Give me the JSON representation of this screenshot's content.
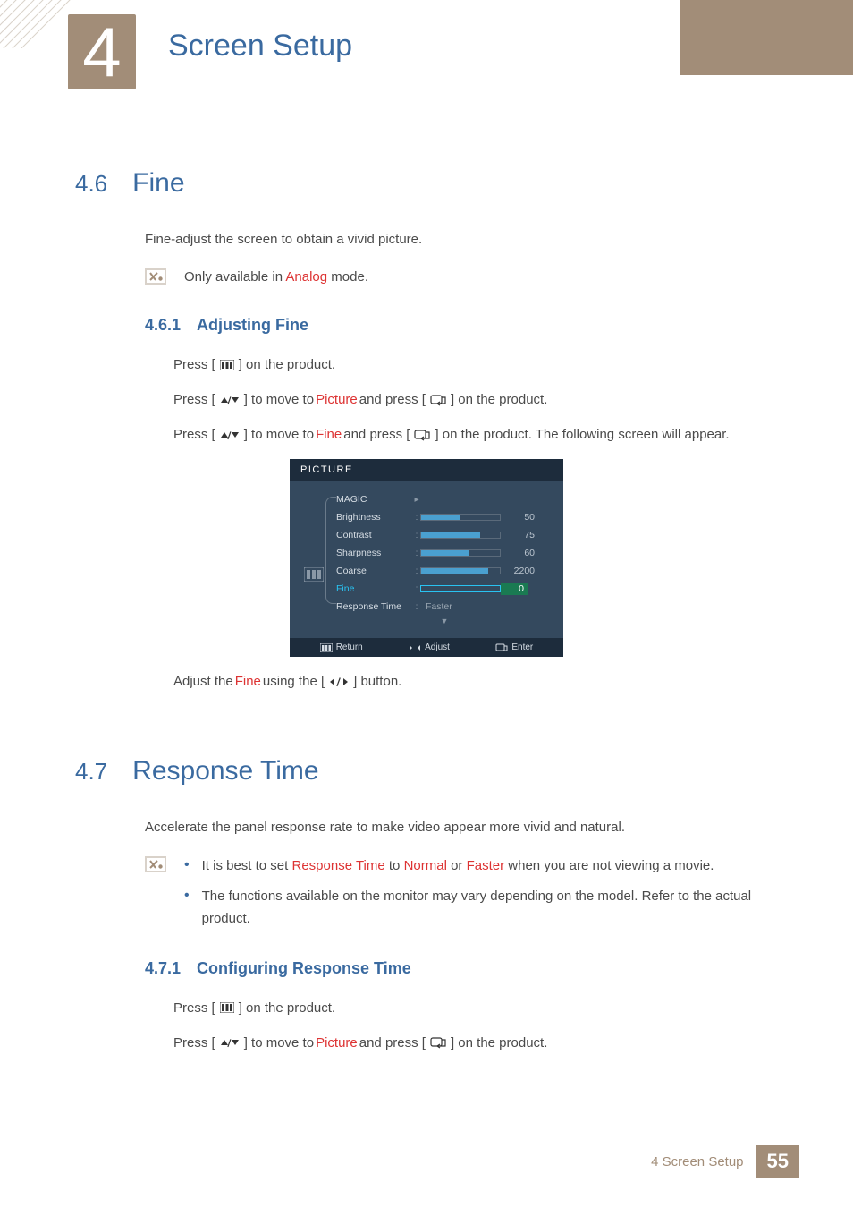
{
  "chapter": {
    "number": "4",
    "title": "Screen Setup"
  },
  "section1": {
    "num": "4.6",
    "title": "Fine",
    "intro": "Fine-adjust the screen to obtain a vivid picture.",
    "note_pre": "Only available in ",
    "note_red": "Analog",
    "note_post": " mode.",
    "sub": {
      "num": "4.6.1",
      "title": "Adjusting Fine",
      "full": "4.6.1 Adjusting Fine"
    },
    "step1_a": "Press [",
    "step1_b": "] on the product.",
    "step2_a": "Press [",
    "step2_b": "] to move to ",
    "step2_red": "Picture",
    "step2_c": " and press [",
    "step2_d": "] on the product.",
    "step3_a": "Press [",
    "step3_b": "] to move to ",
    "step3_red": "Fine",
    "step3_c": " and press [",
    "step3_d": "] on the product. The following screen will appear.",
    "adjust_a": "Adjust the ",
    "adjust_red": "Fine",
    "adjust_b": " using the [",
    "adjust_c": "] button."
  },
  "osd": {
    "title": "PICTURE",
    "rows": [
      {
        "label": "MAGIC",
        "val": "",
        "bar": null
      },
      {
        "label": "Brightness",
        "val": "50",
        "bar": 50
      },
      {
        "label": "Contrast",
        "val": "75",
        "bar": 75
      },
      {
        "label": "Sharpness",
        "val": "60",
        "bar": 60
      },
      {
        "label": "Coarse",
        "val": "2200",
        "bar": 85
      },
      {
        "label": "Fine",
        "val": "0",
        "bar": 0,
        "selected": true
      },
      {
        "label": "Response Time",
        "val": "Faster"
      }
    ],
    "foot": {
      "return": "Return",
      "adjust": "Adjust",
      "enter": "Enter"
    }
  },
  "section2": {
    "num": "4.7",
    "title": "Response Time",
    "intro": "Accelerate the panel response rate to make video appear more vivid and natural.",
    "b1_a": "It is best to set ",
    "b1_r1": "Response Time",
    "b1_b": " to ",
    "b1_r2": "Normal",
    "b1_c": " or ",
    "b1_r3": "Faster",
    "b1_d": " when you are not viewing a movie.",
    "b2": "The functions available on the monitor may vary depending on the model. Refer to the actual product.",
    "sub": {
      "full": "4.7.1 Configuring Response Time"
    },
    "step1_a": "Press [",
    "step1_b": "] on the product.",
    "step2_a": "Press [",
    "step2_b": "] to move to ",
    "step2_red": "Picture",
    "step2_c": " and press [",
    "step2_d": "] on the product."
  },
  "footer": {
    "text": "4 Screen Setup",
    "page": "55"
  }
}
